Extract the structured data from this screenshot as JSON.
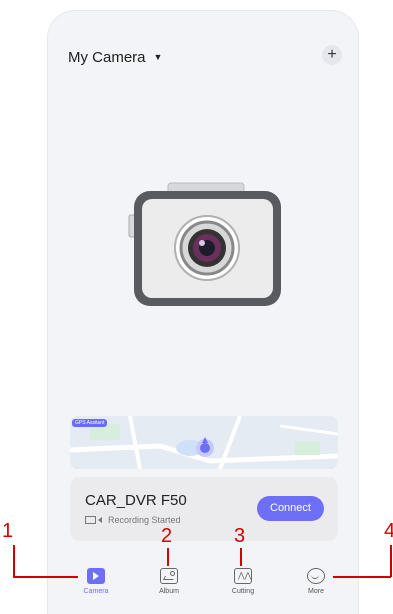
{
  "header": {
    "title": "My Camera",
    "caret": "▼",
    "add_icon": "+"
  },
  "map": {
    "badge": "GPS Assitant"
  },
  "device": {
    "name": "CAR_DVR F50",
    "status": "Recording Started",
    "connect_label": "Connect"
  },
  "tabs": [
    {
      "label": "Camera",
      "icon": "camera-tab-icon",
      "active": true
    },
    {
      "label": "Album",
      "icon": "album-icon"
    },
    {
      "label": "Cutting",
      "icon": "cutting-icon"
    },
    {
      "label": "More",
      "icon": "more-icon"
    }
  ],
  "annotations": {
    "n1": "1",
    "n2": "2",
    "n3": "3",
    "n4": "4"
  },
  "colors": {
    "accent": "#6e6ff7",
    "callout": "#d40000"
  }
}
